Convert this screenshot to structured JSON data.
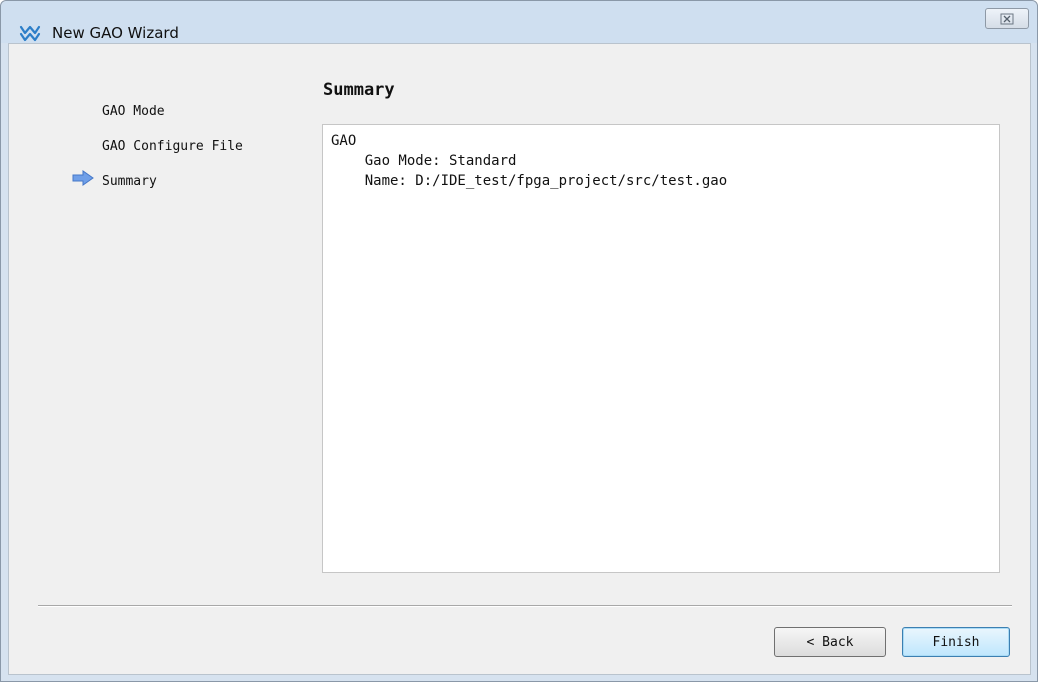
{
  "window": {
    "title": "New GAO Wizard",
    "close_glyph": "⊠"
  },
  "steps": [
    {
      "label": "GAO Mode",
      "current": false
    },
    {
      "label": "GAO Configure File",
      "current": false
    },
    {
      "label": "Summary",
      "current": true
    }
  ],
  "page": {
    "title": "Summary"
  },
  "summary": {
    "lines": [
      "GAO",
      "    Gao Mode: Standard",
      "    Name: D:/IDE_test/fpga_project/src/test.gao"
    ]
  },
  "buttons": {
    "back": "< Back",
    "finish": "Finish"
  },
  "icons": {
    "app": "gowin-logo-icon",
    "current_step": "arrow-right-icon",
    "close": "close-icon"
  },
  "colors": {
    "arrow": "#5b8fe0",
    "logo": "#2c7ec8"
  }
}
